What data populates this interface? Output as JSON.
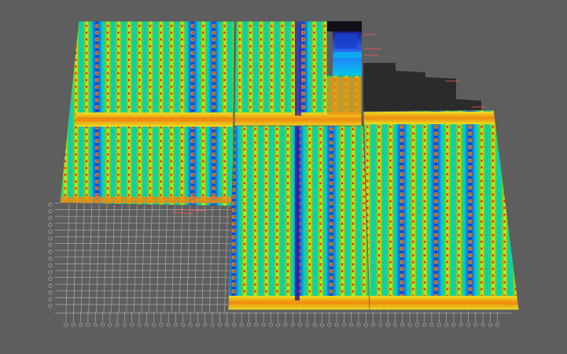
{
  "colors": {
    "background": "#5e5e5e",
    "gridlines": "#a8a8a8",
    "gridline_circle": "#b0b0b0",
    "shadow": "#2b2b2b",
    "contour_low": "#2030c0",
    "contour_mid_low": "#00c8e8",
    "contour_mid": "#38d838",
    "contour_mid_high": "#e8e020",
    "contour_high": "#f08a10",
    "contour_max": "#e01010",
    "annotation": "#ff5a5a",
    "hole": "#101018"
  },
  "icons": {
    "grid_axis_marker": "circle"
  }
}
